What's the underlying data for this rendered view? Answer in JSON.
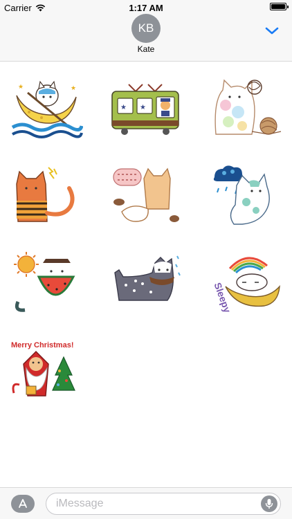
{
  "status_bar": {
    "carrier": "Carrier",
    "time": "1:17 AM"
  },
  "header": {
    "avatar_initials": "KB",
    "contact_name": "Kate"
  },
  "stickers": [
    {
      "name": "cat-rowing-moon-boat-sticker"
    },
    {
      "name": "cat-train-conductor-sticker"
    },
    {
      "name": "cat-yarn-ball-sticker"
    },
    {
      "name": "cat-tiger-striped-sticker"
    },
    {
      "name": "cat-speech-bubble-sticker"
    },
    {
      "name": "cat-rain-cloud-sticker"
    },
    {
      "name": "cat-watermelon-sun-sticker"
    },
    {
      "name": "cat-polka-dot-scarf-sticker"
    },
    {
      "name": "cat-sleepy-moon-rainbow-sticker",
      "text": "Sleepy"
    },
    {
      "name": "cat-merry-christmas-santa-sticker",
      "text": "Merry Christmas!"
    }
  ],
  "compose": {
    "placeholder": "iMessage"
  },
  "icons": {
    "chevron": "chevron-down-icon",
    "appstore": "app-store-icon",
    "mic": "microphone-icon",
    "wifi": "wifi-icon",
    "battery": "battery-icon"
  },
  "colors": {
    "accent": "#1a7cf5",
    "avatar": "#8e9298",
    "bar_background": "#f7f7f7"
  }
}
